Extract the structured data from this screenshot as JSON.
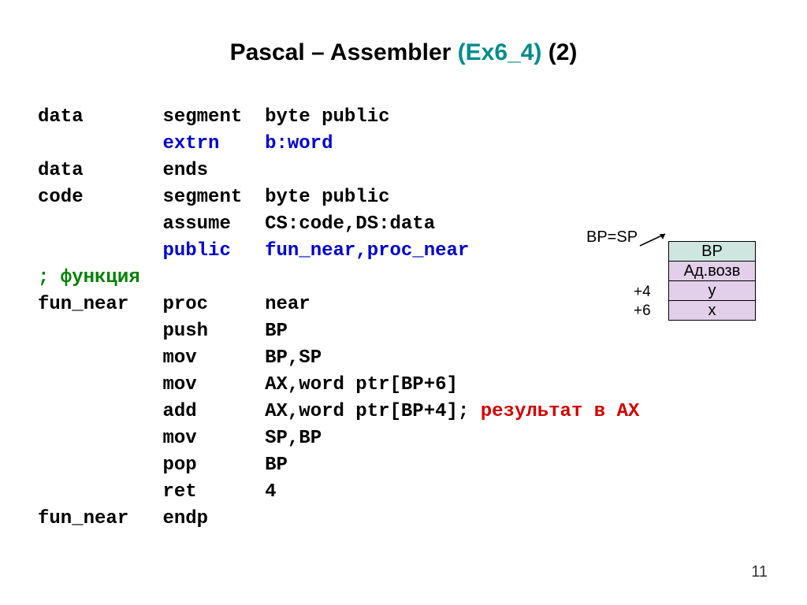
{
  "title": {
    "part1": "Pascal – Assembler ",
    "part_teal": "(Ex6_4)",
    "part3": " (2)"
  },
  "code": {
    "l01_a": "data",
    "l01_b": "segment",
    "l01_c": "byte public",
    "l02_b": "extrn",
    "l02_c": "b:word",
    "l03_a": "data",
    "l03_b": "ends",
    "l04_a": "code",
    "l04_b": "segment",
    "l04_c": "byte public",
    "l05_b": "assume",
    "l05_c": "CS:code,DS:data",
    "l06_b": "public",
    "l06_c": "fun_near,proc_near",
    "l07": "; функция",
    "l08_a": "fun_near",
    "l08_b": "proc",
    "l08_c": "near",
    "l09_b": "push",
    "l09_c": "BP",
    "l10_b": "mov",
    "l10_c": "BP,SP",
    "l11_b": "mov",
    "l11_c": "AX,word ptr[BP+6]",
    "l12_b": "add",
    "l12_c": "AX,word ptr[BP+4]; ",
    "l12_d": "результат в AX",
    "l13_b": "mov",
    "l13_c": "SP,BP",
    "l14_b": "pop",
    "l14_c": "BP",
    "l15_b": "ret",
    "l15_c": "4",
    "l16_a": "fun_near",
    "l16_b": "endp"
  },
  "diagram": {
    "label": "BP=SP",
    "row_bp": "BP",
    "row_ret": "Ад.возв",
    "row_y": "y",
    "row_x": "x",
    "off4": "+4",
    "off6": "+6"
  },
  "page": "11"
}
